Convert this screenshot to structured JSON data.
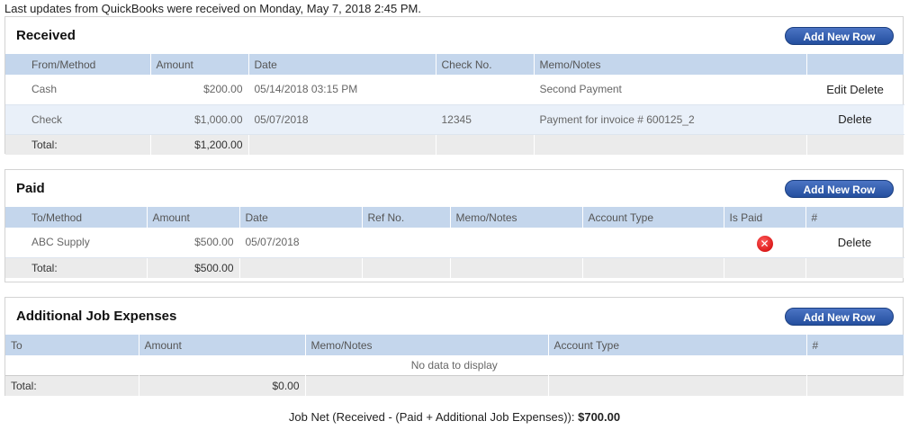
{
  "updates_text": "Last updates from QuickBooks were received on Monday, May 7, 2018 2:45 PM.",
  "add_button_label": "Add New Row",
  "received": {
    "title": "Received",
    "columns": [
      "From/Method",
      "Amount",
      "Date",
      "Check No.",
      "Memo/Notes",
      ""
    ],
    "rows": [
      {
        "method": "Cash",
        "amount": "$200.00",
        "date": "05/14/2018 03:15 PM",
        "check": "",
        "memo": "Second Payment",
        "edit": "Edit",
        "delete": "Delete"
      },
      {
        "method": "Check",
        "amount": "$1,000.00",
        "date": "05/07/2018",
        "check": "12345",
        "memo": "Payment for invoice # 600125_2",
        "delete": "Delete"
      }
    ],
    "total_label": "Total:",
    "total_amount": "$1,200.00"
  },
  "paid": {
    "title": "Paid",
    "columns": [
      "To/Method",
      "Amount",
      "Date",
      "Ref No.",
      "Memo/Notes",
      "Account Type",
      "Is Paid",
      "#"
    ],
    "rows": [
      {
        "to": "ABC Supply",
        "amount": "$500.00",
        "date": "05/07/2018",
        "ref": "",
        "memo": "",
        "account_type": "",
        "is_paid_icon": "red-x-icon",
        "delete": "Delete"
      }
    ],
    "total_label": "Total:",
    "total_amount": "$500.00"
  },
  "expenses": {
    "title": "Additional Job Expenses",
    "columns": [
      "To",
      "Amount",
      "Memo/Notes",
      "Account Type",
      "#"
    ],
    "no_data": "No data to display",
    "total_label": "Total:",
    "total_amount": "$0.00"
  },
  "job_net_label": "Job Net (Received - (Paid + Additional Job Expenses)):",
  "job_net_value": "$700.00",
  "colors": {
    "header_bg": "#c4d6ec",
    "button": "#2a55a6",
    "alt_row": "#e9f0f9",
    "total_bg": "#ebebeb",
    "error_red": "#cc0000"
  }
}
